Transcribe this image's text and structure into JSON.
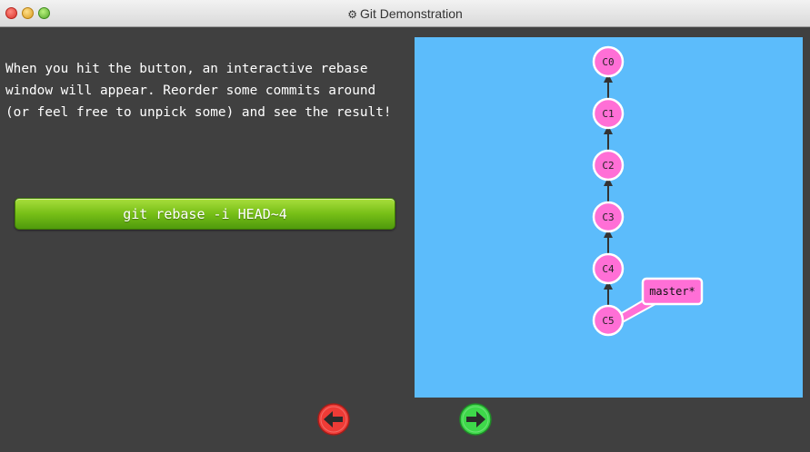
{
  "window": {
    "title": "Git Demonstration",
    "title_icon": "gear-icon"
  },
  "instructions": {
    "text": "When you hit the button, an interactive rebase window will appear. Reorder some commits around (or feel free to unpick some) and see the result!"
  },
  "command_button": {
    "label": "git rebase -i HEAD~4",
    "color": "#6bb51a"
  },
  "visualization": {
    "background": "#5cbcfb",
    "commit_color": "#ff6fd6",
    "commits": [
      "C0",
      "C1",
      "C2",
      "C3",
      "C4",
      "C5"
    ],
    "branch": {
      "name": "master*",
      "target": "C5"
    }
  },
  "navigation": {
    "back_icon": "arrow-left-icon",
    "back_color": "#ee3b36",
    "forward_icon": "arrow-right-icon",
    "forward_color": "#3ed84a"
  }
}
